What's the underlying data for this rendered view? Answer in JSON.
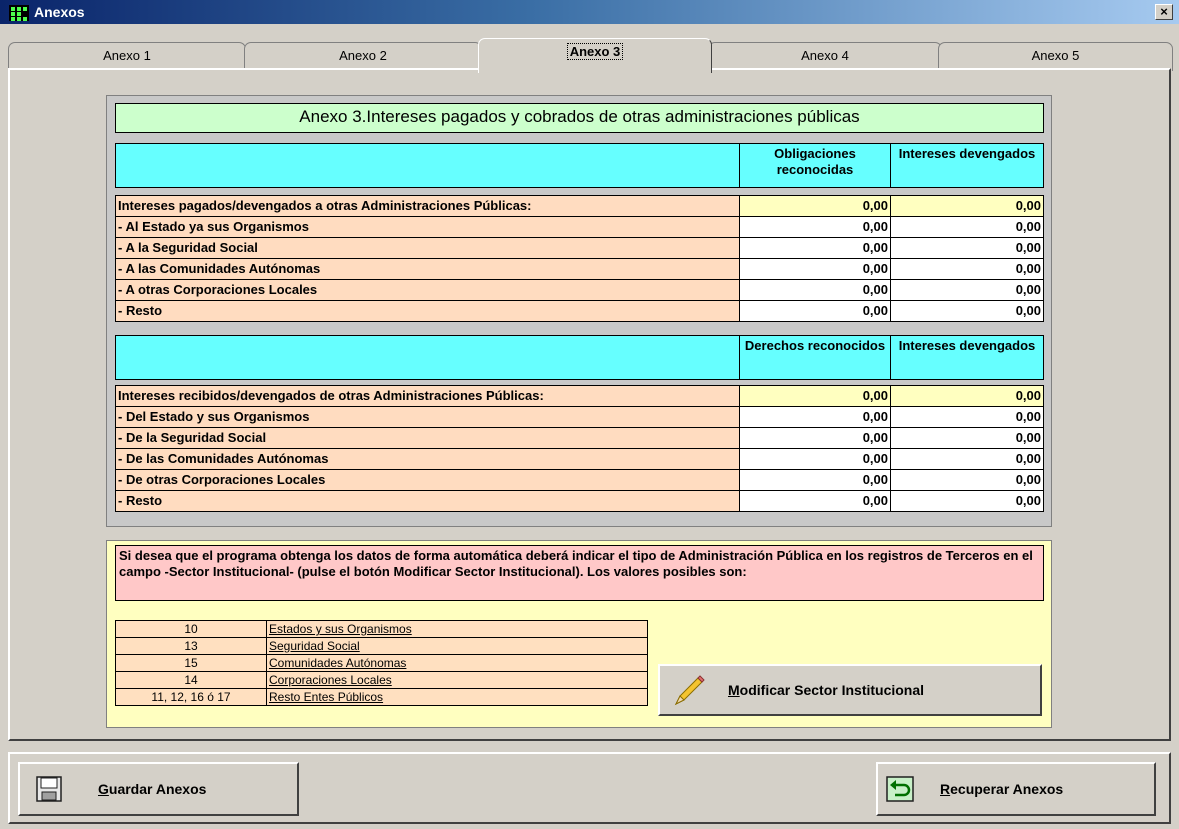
{
  "window": {
    "title": "Anexos",
    "close_label": "×"
  },
  "tabs": [
    "Anexo 1",
    "Anexo 2",
    "Anexo 3",
    "Anexo 4",
    "Anexo 5"
  ],
  "active_tab": 2,
  "annex": {
    "title": "Anexo 3.Intereses pagados y cobrados de otras administraciones públicas",
    "section1": {
      "col1": "Obligaciones reconocidas",
      "col2": "Intereses devengados",
      "rows": [
        {
          "label": "Intereses pagados/devengados a otras Administraciones Públicas:",
          "v1": "0,00",
          "v2": "0,00"
        },
        {
          "label": "- Al Estado ya sus Organismos",
          "v1": "0,00",
          "v2": "0,00"
        },
        {
          "label": "- A la Seguridad Social",
          "v1": "0,00",
          "v2": "0,00"
        },
        {
          "label": "- A las Comunidades Autónomas",
          "v1": "0,00",
          "v2": "0,00"
        },
        {
          "label": "- A otras Corporaciones Locales",
          "v1": "0,00",
          "v2": "0,00"
        },
        {
          "label": "- Resto",
          "v1": "0,00",
          "v2": "0,00"
        }
      ]
    },
    "section2": {
      "col1": "Derechos reconocidos",
      "col2": "Intereses devengados",
      "rows": [
        {
          "label": "Intereses recibidos/devengados de otras Administraciones Públicas:",
          "v1": "0,00",
          "v2": "0,00"
        },
        {
          "label": "- Del Estado y sus Organismos",
          "v1": "0,00",
          "v2": "0,00"
        },
        {
          "label": "- De la Seguridad Social",
          "v1": "0,00",
          "v2": "0,00"
        },
        {
          "label": "- De las Comunidades Autónomas",
          "v1": "0,00",
          "v2": "0,00"
        },
        {
          "label": "- De otras Corporaciones Locales",
          "v1": "0,00",
          "v2": "0,00"
        },
        {
          "label": "- Resto",
          "v1": "0,00",
          "v2": "0,00"
        }
      ]
    }
  },
  "info": {
    "message": "Si desea que el programa obtenga los datos de forma automática deberá indicar el tipo de Administración Pública en los registros de Terceros en el campo -Sector Institucional- (pulse el botón Modificar Sector Institucional). Los valores posibles son:",
    "values": [
      {
        "code": "10",
        "desc": "Estados y sus Organismos"
      },
      {
        "code": "13",
        "desc": "Seguridad Social"
      },
      {
        "code": "15",
        "desc": "Comunidades Autónomas"
      },
      {
        "code": "14",
        "desc": "Corporaciones Locales"
      },
      {
        "code": "11, 12, 16 ó 17",
        "desc": "Resto Entes Públicos"
      }
    ]
  },
  "buttons": {
    "modify_first": "M",
    "modify_rest": "odificar Sector Institucional",
    "save_first": "G",
    "save_rest": "uardar Anexos",
    "recover_first": "R",
    "recover_rest": "ecuperar Anexos"
  },
  "icons": {
    "modify": "pencil-icon",
    "save": "floppy-disk-icon",
    "recover": "undo-arrow-icon"
  }
}
